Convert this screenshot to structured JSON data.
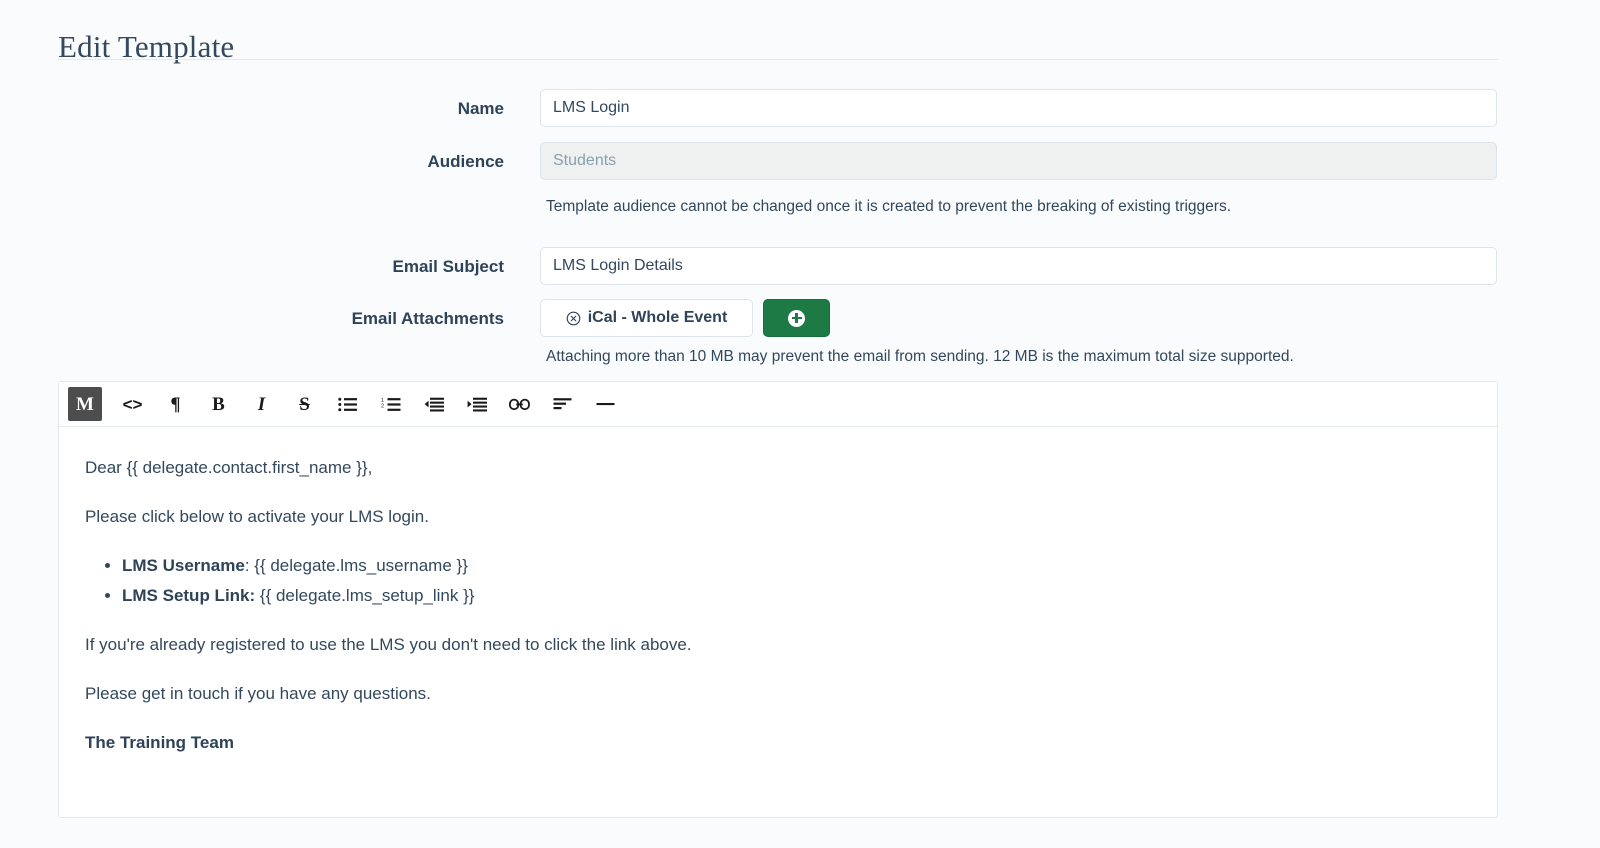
{
  "page": {
    "title": "Edit Template"
  },
  "form": {
    "name": {
      "label": "Name",
      "value": "LMS Login",
      "placeholder": ""
    },
    "audience": {
      "label": "Audience",
      "value": "Students",
      "helper": "Template audience cannot be changed once it is created to prevent the breaking of existing triggers."
    },
    "email_subject": {
      "label": "Email Subject",
      "value": "LMS Login Details",
      "placeholder": ""
    },
    "email_attachments": {
      "label": "Email Attachments",
      "chip_label": "iCal - Whole Event",
      "remove_icon": "circled-x-icon",
      "add_icon": "plus-circle-icon",
      "helper": "Attaching more than 10 MB may prevent the email from sending. 12 MB is the maximum total size supported."
    }
  },
  "editor": {
    "toolbar": [
      {
        "name": "markdown-toggle",
        "glyph": "M",
        "active": true
      },
      {
        "name": "code-block",
        "glyph": "<>",
        "active": false
      },
      {
        "name": "paragraph",
        "glyph": "¶",
        "active": false
      },
      {
        "name": "bold",
        "glyph": "B",
        "active": false
      },
      {
        "name": "italic",
        "glyph": "I",
        "active": false
      },
      {
        "name": "strikethrough",
        "glyph": "S",
        "active": false
      },
      {
        "name": "bullet-list",
        "glyph": "",
        "active": false
      },
      {
        "name": "numbered-list",
        "glyph": "",
        "active": false
      },
      {
        "name": "outdent",
        "glyph": "",
        "active": false
      },
      {
        "name": "indent",
        "glyph": "",
        "active": false
      },
      {
        "name": "link",
        "glyph": "",
        "active": false
      },
      {
        "name": "align-left",
        "glyph": "",
        "active": false
      },
      {
        "name": "horizontal-rule",
        "glyph": "",
        "active": false
      }
    ],
    "content": {
      "greeting": "Dear {{ delegate.contact.first_name }},",
      "intro": "Please click below to activate your LMS login.",
      "bullets": [
        {
          "bold": "LMS Username",
          "rest": ": {{ delegate.lms_username }}"
        },
        {
          "bold": "LMS Setup Link:",
          "rest": " {{ delegate.lms_setup_link }}"
        }
      ],
      "note": "If you're already registered to use the LMS you don't need to click the link above.",
      "closing": "Please get in touch if you have any questions.",
      "signature": "The Training Team"
    }
  },
  "colors": {
    "accent_green": "#1d7a44",
    "text_navy": "#2e4358",
    "body_text": "#33485d",
    "background": "#fafbfd",
    "border": "#dde4ea",
    "toolbar_active": "#4d4d4d"
  }
}
